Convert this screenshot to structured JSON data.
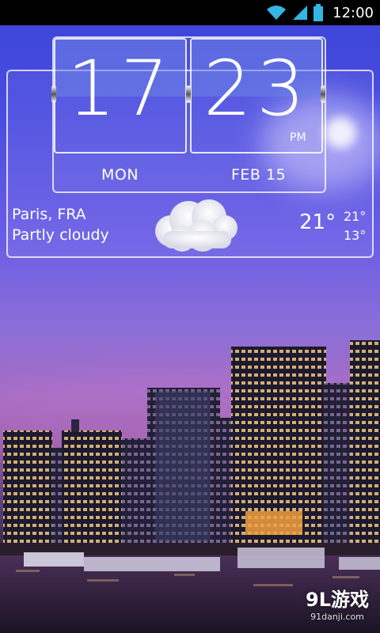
{
  "status_bar": {
    "time": "12:00",
    "icons": [
      "wifi-icon",
      "signal-icon",
      "battery-icon"
    ]
  },
  "clock": {
    "hour": "17",
    "minute": "23",
    "ampm": "PM",
    "day": "MON",
    "date": "FEB 15"
  },
  "weather": {
    "city": "Paris, FRA",
    "condition": "Partly cloudy",
    "current_temp": "21°",
    "high_temp": "21°",
    "low_temp": "13°",
    "icon": "partly-cloudy-icon"
  },
  "watermark": {
    "logo": "9L游戏",
    "url": "91danji.com"
  },
  "colors": {
    "status_bar": "#000000",
    "sky_top": "#3b44d8",
    "sky_mid": "#a46cc4",
    "frame": "#ffffff",
    "text": "#ffffff"
  }
}
